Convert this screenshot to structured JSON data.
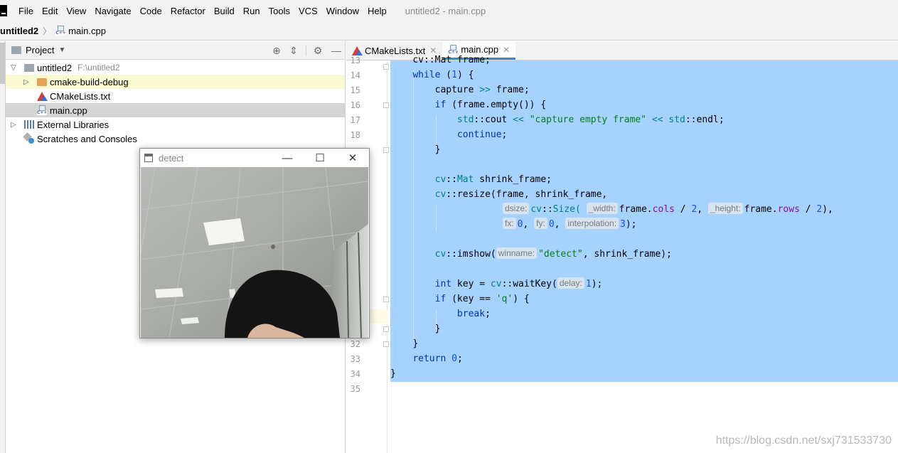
{
  "menubar": {
    "items": [
      "File",
      "Edit",
      "View",
      "Navigate",
      "Code",
      "Refactor",
      "Build",
      "Run",
      "Tools",
      "VCS",
      "Window",
      "Help"
    ],
    "window_title": "untitled2 - main.cpp"
  },
  "breadcrumb": {
    "project": "untitled2",
    "file": "main.cpp"
  },
  "project_panel": {
    "title": "Project",
    "tree": [
      {
        "label": "untitled2",
        "path": "F:\\untitled2"
      },
      {
        "label": "cmake-build-debug"
      },
      {
        "label": "CMakeLists.txt"
      },
      {
        "label": "main.cpp"
      },
      {
        "label": "External Libraries"
      },
      {
        "label": "Scratches and Consoles"
      }
    ]
  },
  "editor": {
    "tabs": [
      {
        "label": "CMakeLists.txt"
      },
      {
        "label": "main.cpp"
      }
    ],
    "line_numbers": [
      "13",
      "14",
      "15",
      "16",
      "17",
      "18",
      "",
      "",
      "",
      "",
      "",
      "",
      "",
      "",
      "",
      "",
      "",
      "",
      "",
      "32",
      "33",
      "34",
      "35"
    ],
    "code": {
      "l13": "cv::Mat frame;",
      "l14_kw": "while",
      "l14_rest": " (",
      "l14_num": "1",
      "l14_end": ") {",
      "l15_a": "capture ",
      "l15_op": ">>",
      "l15_b": " frame;",
      "l16_kw": "if",
      "l16_rest": " (frame.empty()) {",
      "l17_ns": "std",
      "l17_a": "::cout ",
      "l17_op": "<<",
      "l17_str": "\"capture empty frame\"",
      "l17_op2": "<<",
      "l17_ns2": "std",
      "l17_end": "::endl;",
      "l18_kw": "continue",
      "l18_end": ";",
      "l19": "}",
      "l21_ns": "cv",
      "l21_a": "::",
      "l21_type": "Mat",
      "l21_b": " shrink_frame;",
      "l22_ns": "cv",
      "l22_a": "::resize(frame, shrink_frame,",
      "l23_hint1": "dsize:",
      "l23_ns": "cv",
      "l23_a": "::",
      "l23_type": "Size(",
      "l23_hint2": "_width:",
      "l23_b": "frame.",
      "l23_fld1": "cols",
      "l23_c": " / ",
      "l23_n1": "2",
      "l23_d": ", ",
      "l23_hint3": "_height:",
      "l23_e": "frame.",
      "l23_fld2": "rows",
      "l23_f": " / ",
      "l23_n2": "2",
      "l23_g": "),",
      "l24_hint1": "fx:",
      "l24_n1": "0",
      "l24_a": ", ",
      "l24_hint2": "fy:",
      "l24_n2": "0",
      "l24_b": ", ",
      "l24_hint3": "interpolation:",
      "l24_n3": "3",
      "l24_c": ");",
      "l26_ns": "cv",
      "l26_a": "::imshow(",
      "l26_hint": "winname:",
      "l26_str": "\"detect\"",
      "l26_b": ", shrink_frame);",
      "l28_kw": "int",
      "l28_a": " key = ",
      "l28_ns": "cv",
      "l28_b": "::waitKey(",
      "l28_hint": "delay:",
      "l28_num": "1",
      "l28_c": ");",
      "l29_kw": "if",
      "l29_a": " (key == ",
      "l29_str": "'q'",
      "l29_b": ") {",
      "l30_kw": "break",
      "l30_end": ";",
      "l31": "}",
      "l32": "}",
      "l33_kw": "return",
      "l33_sp": " ",
      "l33_num": "0",
      "l33_end": ";",
      "l34": "}"
    }
  },
  "detect_window": {
    "title": "detect"
  },
  "watermark": "https://blog.csdn.net/sxj731533730",
  "colors": {
    "selection": "#a6d2ff",
    "keyword": "#0033b3",
    "string": "#067d17",
    "number": "#1750eb",
    "accent": "#4083c9"
  }
}
